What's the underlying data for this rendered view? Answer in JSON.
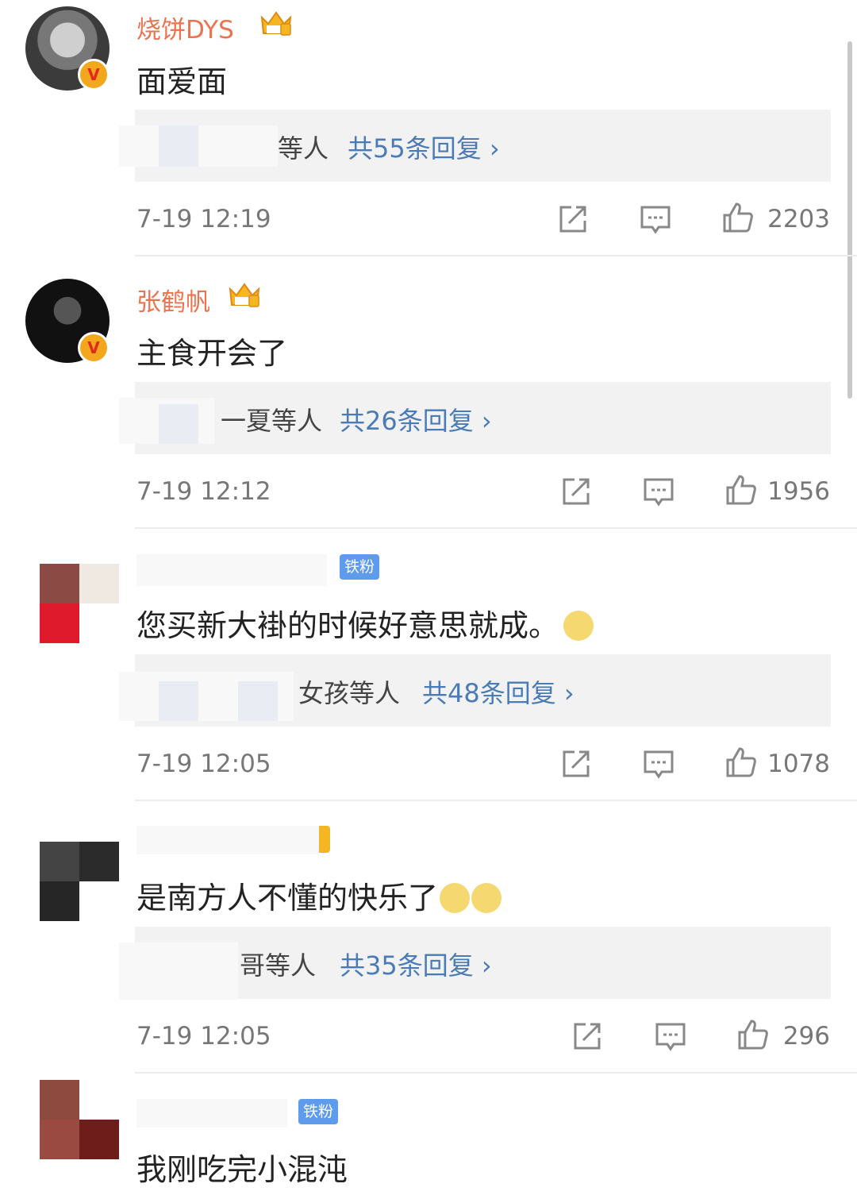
{
  "comments": [
    {
      "name": "烧饼DYS",
      "text": "面爱面",
      "reply_who": "等人",
      "reply_count": "共55条回复 ›",
      "time": "7-19 12:19",
      "likes": "2203"
    },
    {
      "name": "张鹤帆",
      "text": "主食开会了",
      "reply_who": "一夏等人",
      "reply_count": "共26条回复 ›",
      "time": "7-19 12:12",
      "likes": "1956"
    },
    {
      "badge": "铁粉",
      "text": "您买新大褂的时候好意思就成。",
      "reply_who": "女孩等人",
      "reply_count": "共48条回复 ›",
      "time": "7-19 12:05",
      "likes": "1078"
    },
    {
      "text": "是南方人不懂的快乐了",
      "reply_who": "哥等人",
      "reply_count": "共35条回复 ›",
      "time": "7-19 12:05",
      "likes": "296"
    },
    {
      "badge": "铁粉",
      "text": "我刚吃完小混沌"
    }
  ],
  "colors": {
    "name": "#eb7350",
    "link": "#4a7bb7",
    "fan_badge": "#5f9bec",
    "verified": "#f3a71d"
  },
  "icons": [
    "share-icon",
    "comment-icon",
    "like-icon",
    "crown-icon",
    "verified-icon",
    "emoji-icon"
  ]
}
